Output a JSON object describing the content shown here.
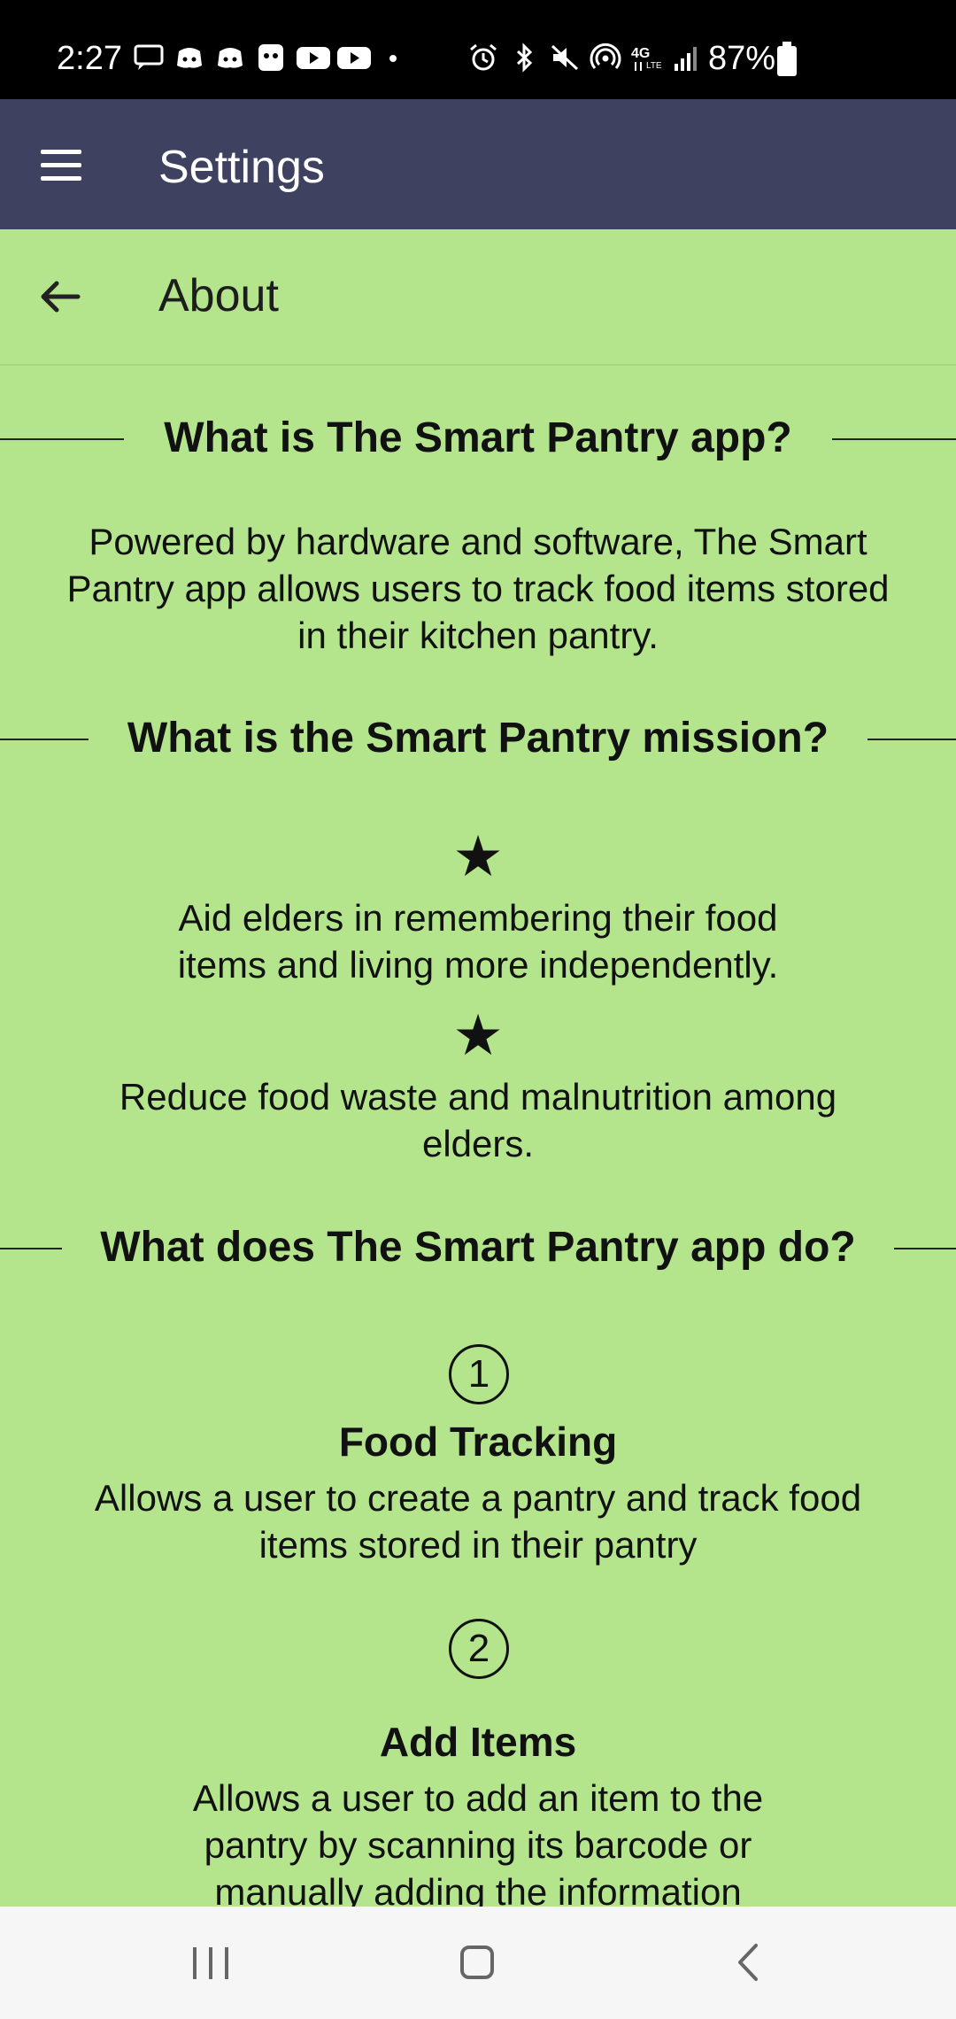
{
  "status_bar": {
    "time": "2:27",
    "left_icons": [
      "chat-icon",
      "discord-icon",
      "discord-icon",
      "app-icon",
      "youtube-icon",
      "youtube-icon",
      "dot-icon"
    ],
    "right_icons": [
      "alarm-icon",
      "bluetooth-icon",
      "mute-icon",
      "hotspot-icon",
      "4g-lte-icon",
      "signal-icon"
    ],
    "battery": "87%"
  },
  "app_bar": {
    "title": "Settings"
  },
  "subheader": {
    "title": "About"
  },
  "sections": {
    "what_is": {
      "heading": "What is The Smart Pantry app?",
      "body": "Powered by hardware and software, The Smart Pantry app allows users to track food items stored in their kitchen pantry."
    },
    "mission": {
      "heading": "What is the Smart Pantry mission?",
      "items": [
        {
          "symbol": "★",
          "text": "Aid elders in remembering their food items and living more independently."
        },
        {
          "symbol": "★",
          "text": "Reduce food waste and malnutrition among elders."
        }
      ]
    },
    "features": {
      "heading": "What does The Smart Pantry app do?",
      "items": [
        {
          "number": "1",
          "title": "Food Tracking",
          "text": "Allows a user to create a pantry and track food items stored in their pantry"
        },
        {
          "number": "2",
          "title": "Add Items",
          "text": "Allows a user to add an item to the pantry by scanning its barcode or manually adding the information"
        }
      ]
    }
  },
  "colors": {
    "status_bar": "#000000",
    "app_bar": "#3e4160",
    "background": "#b4e58c",
    "nav_bar": "#f6f6f6"
  }
}
